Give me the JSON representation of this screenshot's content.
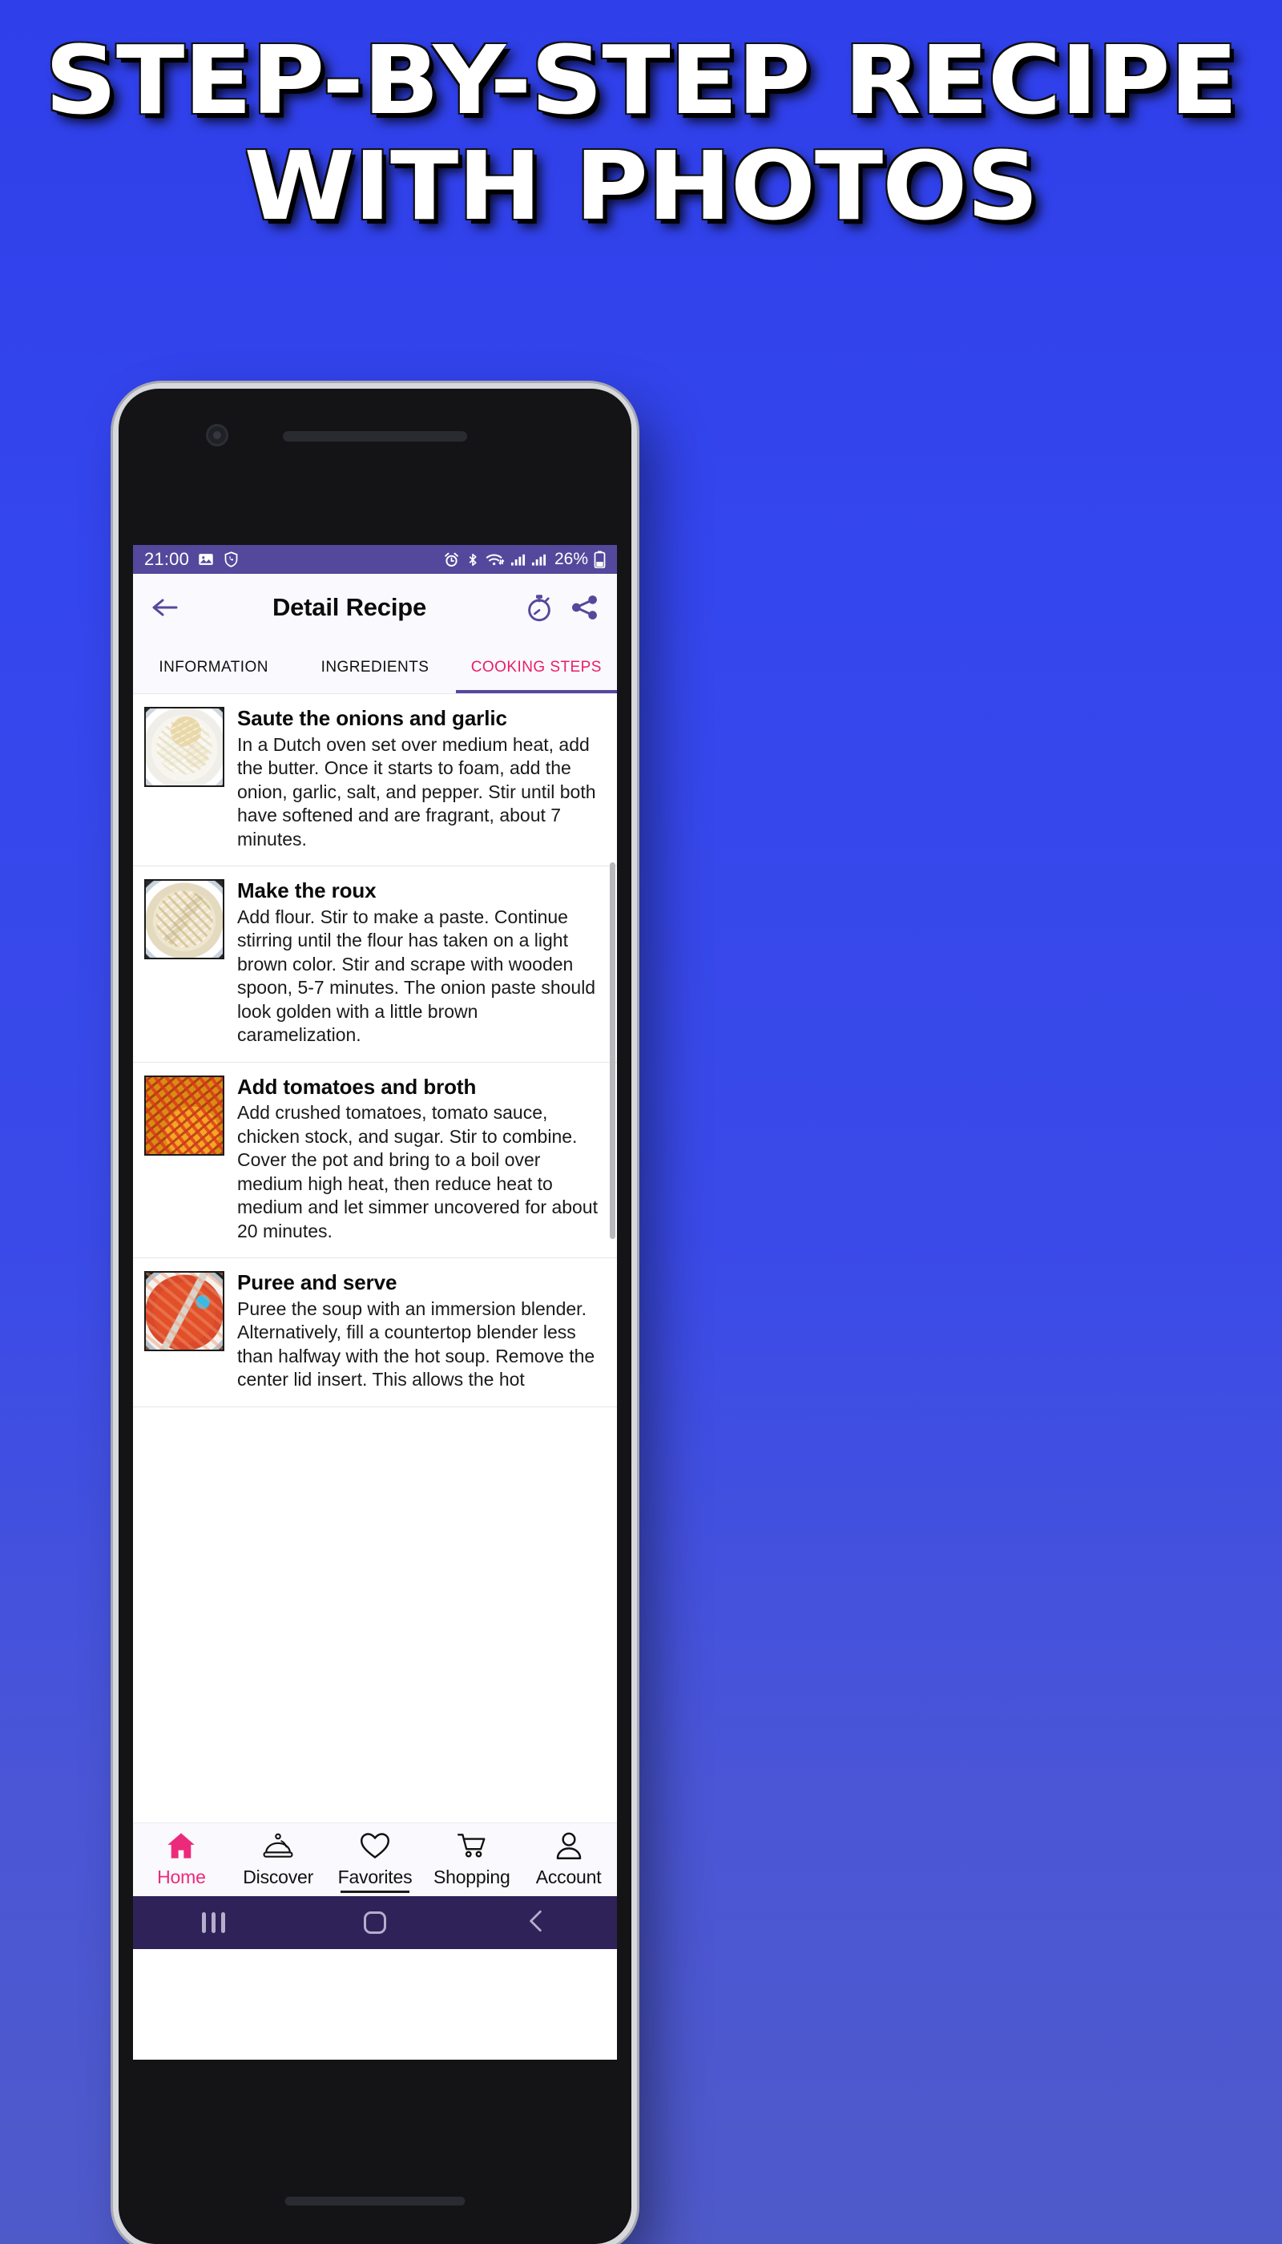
{
  "promo": {
    "headline_line1": "STEP-BY-STEP RECIPE",
    "headline_line2": "WITH PHOTOS",
    "background_color": "#3446ee"
  },
  "status_bar": {
    "time": "21:00",
    "battery_percent": "26%",
    "icons_left": [
      "image-icon",
      "shield-phone-icon"
    ],
    "icons_right": [
      "alarm-icon",
      "bluetooth-icon",
      "wifi-icon",
      "signal-icon",
      "signal-icon-2",
      "battery-icon"
    ],
    "background_color": "#54489c"
  },
  "appbar": {
    "back_label": "Back",
    "title": "Detail Recipe",
    "timer_label": "Timer",
    "share_label": "Share",
    "accent_color": "#54489c"
  },
  "tabs": {
    "active_index": 2,
    "active_color": "#e91e63",
    "indicator_color": "#54489c",
    "items": [
      {
        "label": "INFORMATION"
      },
      {
        "label": "INGREDIENTS"
      },
      {
        "label": "COOKING STEPS"
      }
    ]
  },
  "steps": [
    {
      "title": "Saute the onions and garlic",
      "description": "In a Dutch oven set over medium heat, add the butter. Once it starts to foam, add the onion, garlic, salt, and pepper. Stir until both have softened and are fragrant, about 7 minutes.",
      "image_alt": "diced-onions-in-pot"
    },
    {
      "title": "Make the roux",
      "description": "Add flour. Stir to make a paste. Continue stirring until the flour has taken on a light brown color. Stir and scrape with wooden spoon, 5-7 minutes. The onion paste should look golden with a little brown caramelization.",
      "image_alt": "flour-roux-with-wooden-spoon"
    },
    {
      "title": "Add tomatoes and broth",
      "description": "Add crushed tomatoes, tomato sauce, chicken stock, and sugar. Stir to combine. Cover the pot and bring to a boil over medium high heat, then reduce heat to medium and let simmer uncovered for about 20 minutes.",
      "image_alt": "crushed-tomatoes-and-broth"
    },
    {
      "title": "Puree and serve",
      "description": "Puree the soup with an immersion blender. Alternatively, fill a countertop blender less than halfway with the hot soup. Remove the center lid insert. This allows the hot",
      "image_alt": "pureed-soup-with-immersion-blender"
    }
  ],
  "bottom_nav": {
    "active_index": 0,
    "active_color": "#ec2a7b",
    "items": [
      {
        "label": "Home",
        "icon": "home-icon"
      },
      {
        "label": "Discover",
        "icon": "cloche-icon"
      },
      {
        "label": "Favorites",
        "icon": "heart-icon"
      },
      {
        "label": "Shopping",
        "icon": "cart-icon"
      },
      {
        "label": "Account",
        "icon": "person-icon"
      }
    ]
  },
  "system_nav": {
    "recent_label": "Recent apps",
    "home_label": "Home",
    "back_label": "Back",
    "background_color": "#2e2258"
  }
}
